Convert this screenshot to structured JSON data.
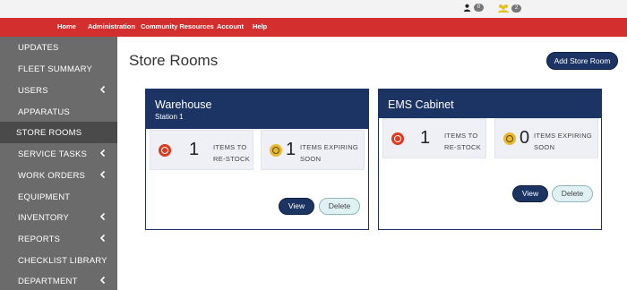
{
  "topbar": {
    "user_count": "0",
    "group_count": "2"
  },
  "nav": {
    "items": [
      "Home",
      "Administration",
      "Community Resources",
      "Account",
      "Help"
    ]
  },
  "sidebar": {
    "items": [
      {
        "label": "UPDATES",
        "chevron": false,
        "active": false
      },
      {
        "label": "FLEET SUMMARY",
        "chevron": false,
        "active": false
      },
      {
        "label": "USERS",
        "chevron": true,
        "active": false
      },
      {
        "label": "APPARATUS",
        "chevron": false,
        "active": false
      },
      {
        "label": "STORE ROOMS",
        "chevron": false,
        "active": true
      },
      {
        "label": "SERVICE TASKS",
        "chevron": true,
        "active": false
      },
      {
        "label": "WORK ORDERS",
        "chevron": true,
        "active": false
      },
      {
        "label": "EQUIPMENT",
        "chevron": false,
        "active": false
      },
      {
        "label": "INVENTORY",
        "chevron": true,
        "active": false
      },
      {
        "label": "REPORTS",
        "chevron": true,
        "active": false
      },
      {
        "label": "CHECKLIST LIBRARY",
        "chevron": false,
        "active": false
      },
      {
        "label": "DEPARTMENT",
        "chevron": true,
        "active": false
      }
    ]
  },
  "main": {
    "title": "Store Rooms",
    "add_button": "Add Store Room",
    "cards": [
      {
        "title": "Warehouse",
        "subtitle": "Station 1",
        "restock_count": "1",
        "restock_label_1": "ITEMS TO",
        "restock_label_2": "RE-STOCK",
        "expiring_count": "1",
        "expiring_label_1": "ITEMS EXPIRING",
        "expiring_label_2": "SOON",
        "view_label": "View",
        "delete_label": "Delete"
      },
      {
        "title": "EMS Cabinet",
        "subtitle": "",
        "restock_count": "1",
        "restock_label_1": "ITEMS TO",
        "restock_label_2": "RE-STOCK",
        "expiring_count": "0",
        "expiring_label_1": "ITEMS EXPIRING",
        "expiring_label_2": "SOON",
        "view_label": "View",
        "delete_label": "Delete"
      }
    ]
  },
  "colors": {
    "navbar": "#d32f2f",
    "sidebar": "#6b6b6b",
    "sidebar_active": "#4a4a4a",
    "card_header": "#1b3463",
    "restock_icon": "#e03a1e",
    "expiring_icon": "#e8b82e"
  },
  "icons": {
    "user": "user-icon",
    "group": "group-icon",
    "restock": "restock-target-icon",
    "expiring": "expiring-target-icon",
    "chevron": "chevron-left-icon"
  }
}
